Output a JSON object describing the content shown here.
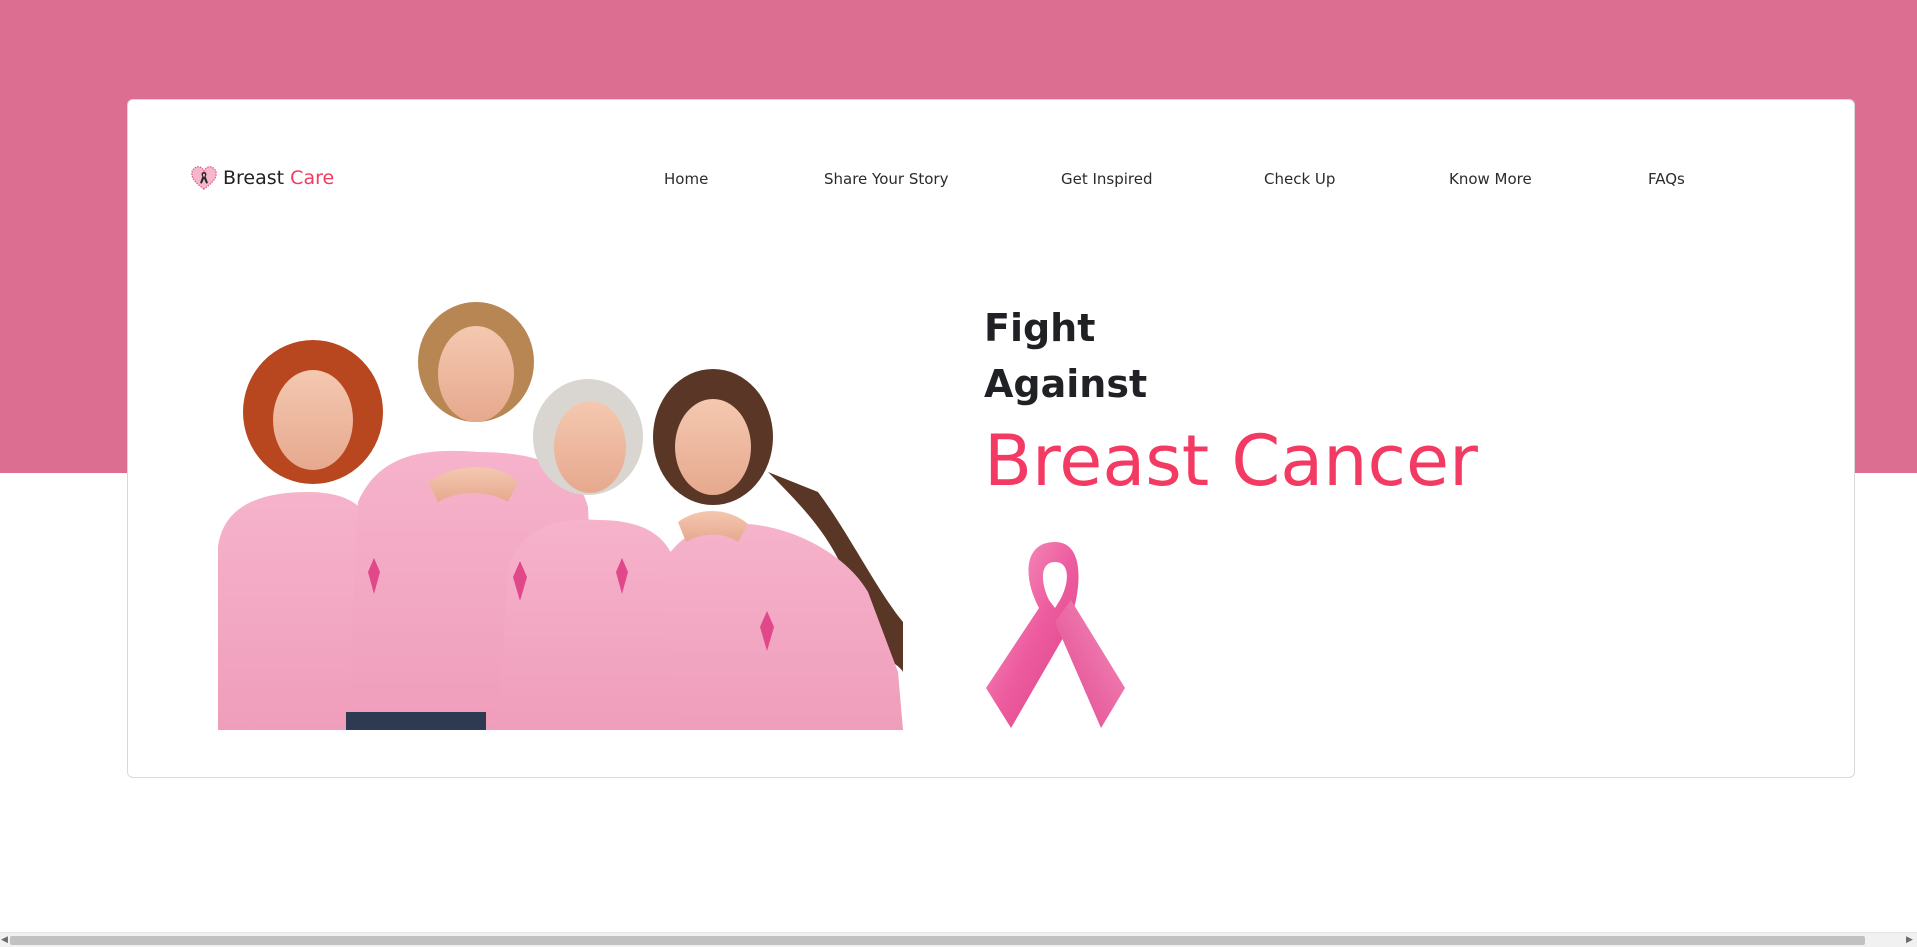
{
  "brand": {
    "name_part1": "Breast",
    "name_part2": "Care",
    "logo_icon": "pink-ribbon-heart-icon"
  },
  "nav": {
    "items": [
      {
        "label": "Home"
      },
      {
        "label": "Share Your Story"
      },
      {
        "label": "Get Inspired"
      },
      {
        "label": "Check Up"
      },
      {
        "label": "Know More"
      },
      {
        "label": "FAQs"
      }
    ]
  },
  "hero": {
    "line1": "Fight",
    "line2": "Against",
    "line3": "Breast Cancer",
    "photo": "group-of-women-in-pink-shirts-photo",
    "ribbon_icon": "pink-awareness-ribbon-icon"
  },
  "colors": {
    "band": "#dc6f91",
    "accent": "#f33a62",
    "text": "#1f2125"
  },
  "scrollbar": {
    "left_arrow": "◀",
    "right_arrow": "▶"
  }
}
